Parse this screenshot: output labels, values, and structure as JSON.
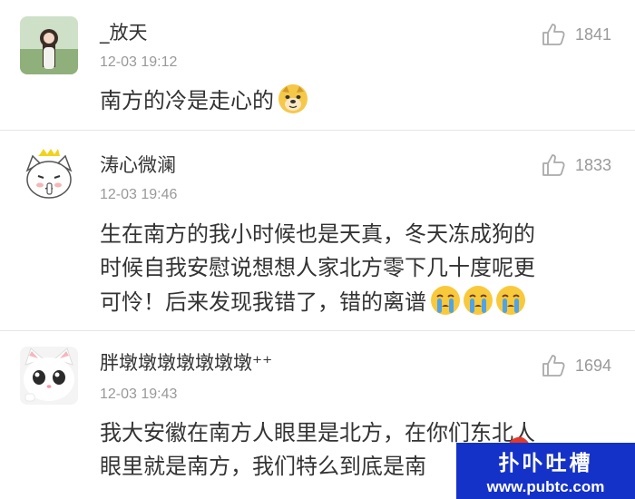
{
  "comments": [
    {
      "username": "_放天",
      "timestamp": "12-03 19:12",
      "likes": "1841",
      "lines": [
        "南方的冷是走心的"
      ],
      "emojis": [
        "doge-emoji"
      ]
    },
    {
      "username": "涛心微澜",
      "timestamp": "12-03 19:46",
      "likes": "1833",
      "lines": [
        "生在南方的我小时候也是天真，冬天冻成狗的",
        "时候自我安慰说想想人家北方零下几十度呢更",
        "可怜！后来发现我错了，错的离谱"
      ],
      "emojis": [
        "crying-emoji",
        "crying-emoji",
        "crying-emoji"
      ]
    },
    {
      "username": "胖墩墩墩墩墩墩墩⁺⁺",
      "timestamp": "12-03 19:43",
      "likes": "1694",
      "lines": [
        "我大安徽在南方人眼里是北方，在你们东北人",
        "眼里就是南方，我们特么到底是南"
      ]
    }
  ],
  "watermark": {
    "title": "扑卟吐槽",
    "url": "www.pubtc.com"
  }
}
